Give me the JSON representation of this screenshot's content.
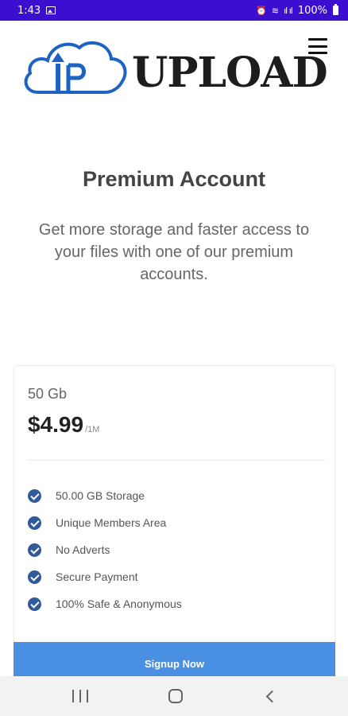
{
  "status_bar": {
    "time": "1:43",
    "signal_text": "ıl ıl",
    "battery": "100%"
  },
  "header": {
    "logo_icon_text": "IP",
    "logo_text": "UPLOAD"
  },
  "hero": {
    "title": "Premium Account",
    "subtitle": "Get more storage and faster access to your files with one of our premium accounts."
  },
  "plan": {
    "name": "50 Gb",
    "price": "$4.99",
    "period": "/1M",
    "features": [
      "50.00 GB Storage",
      "Unique Members Area",
      "No Adverts",
      "Secure Payment",
      "100% Safe & Anonymous"
    ],
    "signup_label": "Signup Now"
  },
  "colors": {
    "status_bar": "#3b0fd0",
    "accent": "#4a90e2",
    "logo_blue": "#1e63c4",
    "check": "#2f5a9e"
  },
  "icons": {
    "menu": "hamburger-icon",
    "check": "check-circle-icon",
    "nav_recent": "recent-apps-icon",
    "nav_home": "home-icon",
    "nav_back": "back-icon"
  }
}
